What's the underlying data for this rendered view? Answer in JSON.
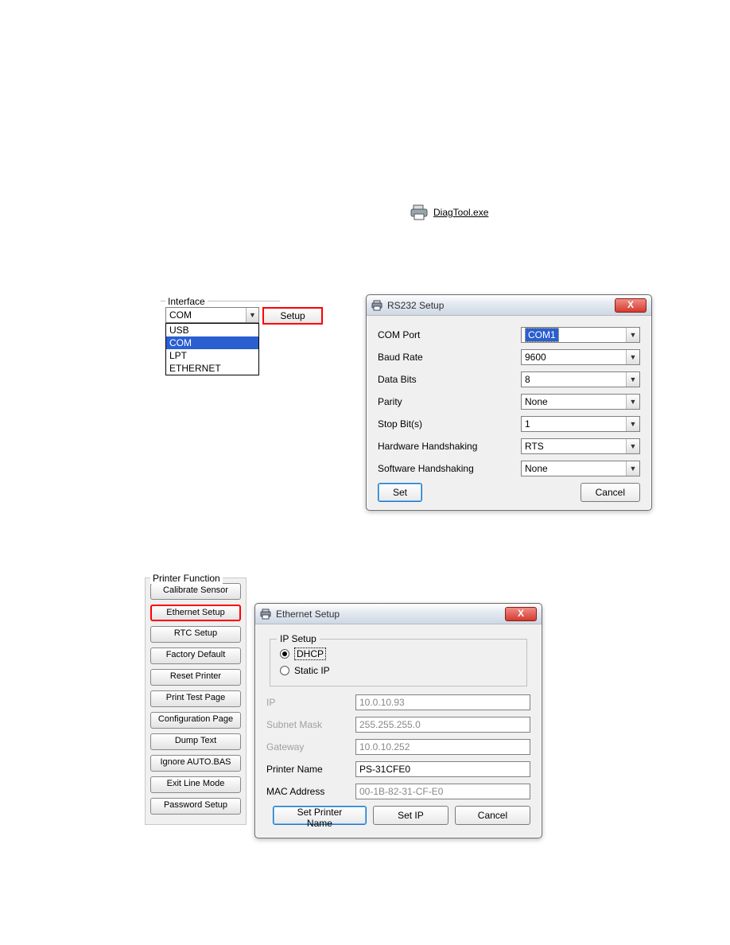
{
  "desktop_icon": {
    "label": "DiagTool.exe"
  },
  "interface": {
    "group_label": "Interface",
    "selected": "COM",
    "options": [
      "USB",
      "COM",
      "LPT",
      "ETHERNET"
    ],
    "setup_label": "Setup"
  },
  "rs232": {
    "title": "RS232 Setup",
    "fields": {
      "com_port": {
        "label": "COM Port",
        "value": "COM1"
      },
      "baud_rate": {
        "label": "Baud Rate",
        "value": "9600"
      },
      "data_bits": {
        "label": "Data Bits",
        "value": "8"
      },
      "parity": {
        "label": "Parity",
        "value": "None"
      },
      "stop_bits": {
        "label": "Stop Bit(s)",
        "value": "1"
      },
      "hw_hs": {
        "label": "Hardware Handshaking",
        "value": "RTS"
      },
      "sw_hs": {
        "label": "Software Handshaking",
        "value": "None"
      }
    },
    "buttons": {
      "set": "Set",
      "cancel": "Cancel"
    }
  },
  "printer_function": {
    "title": "Printer Function",
    "buttons": [
      "Calibrate Sensor",
      "Ethernet Setup",
      "RTC Setup",
      "Factory Default",
      "Reset Printer",
      "Print Test Page",
      "Configuration Page",
      "Dump Text",
      "Ignore AUTO.BAS",
      "Exit Line Mode",
      "Password Setup"
    ]
  },
  "ethernet": {
    "title": "Ethernet Setup",
    "ip_setup": {
      "legend": "IP Setup",
      "dhcp": "DHCP",
      "static": "Static IP",
      "selected": "DHCP"
    },
    "fields": {
      "ip": {
        "label": "IP",
        "value": "10.0.10.93"
      },
      "subnet": {
        "label": "Subnet Mask",
        "value": "255.255.255.0"
      },
      "gateway": {
        "label": "Gateway",
        "value": "10.0.10.252"
      },
      "printer_name": {
        "label": "Printer Name",
        "value": "PS-31CFE0"
      },
      "mac": {
        "label": "MAC Address",
        "value": "00-1B-82-31-CF-E0"
      }
    },
    "buttons": {
      "set_name": "Set Printer Name",
      "set_ip": "Set IP",
      "cancel": "Cancel"
    }
  },
  "glyphs": {
    "dropdown_arrow": "▼",
    "close": "X"
  }
}
